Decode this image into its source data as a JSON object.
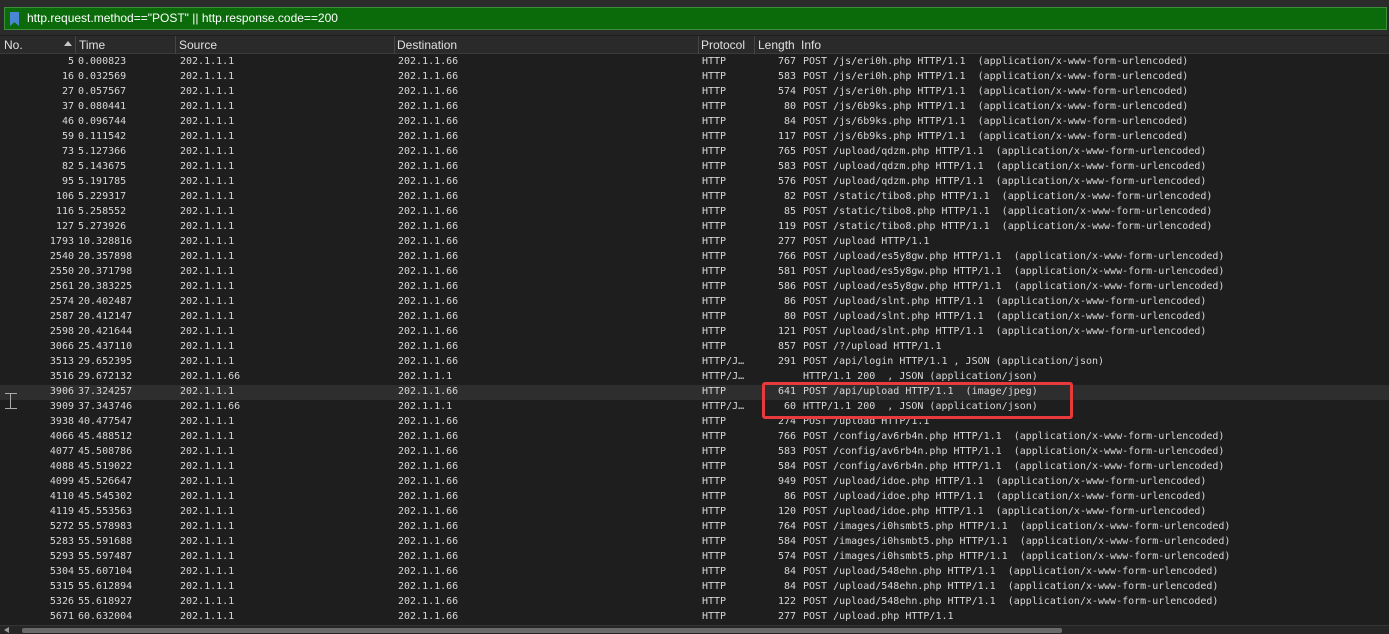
{
  "filter": {
    "expression": "http.request.method==\"POST\" || http.response.code==200"
  },
  "columns": {
    "no": "No.",
    "time": "Time",
    "source": "Source",
    "destination": "Destination",
    "protocol": "Protocol",
    "length": "Length",
    "info": "Info"
  },
  "rows": [
    {
      "no": "5",
      "time": "0.000823",
      "src": "202.1.1.1",
      "dst": "202.1.1.66",
      "proto": "HTTP",
      "len": "767",
      "info": "POST /js/eri0h.php HTTP/1.1  (application/x-www-form-urlencoded)"
    },
    {
      "no": "16",
      "time": "0.032569",
      "src": "202.1.1.1",
      "dst": "202.1.1.66",
      "proto": "HTTP",
      "len": "583",
      "info": "POST /js/eri0h.php HTTP/1.1  (application/x-www-form-urlencoded)"
    },
    {
      "no": "27",
      "time": "0.057567",
      "src": "202.1.1.1",
      "dst": "202.1.1.66",
      "proto": "HTTP",
      "len": "574",
      "info": "POST /js/eri0h.php HTTP/1.1  (application/x-www-form-urlencoded)"
    },
    {
      "no": "37",
      "time": "0.080441",
      "src": "202.1.1.1",
      "dst": "202.1.1.66",
      "proto": "HTTP",
      "len": "80",
      "info": "POST /js/6b9ks.php HTTP/1.1  (application/x-www-form-urlencoded)"
    },
    {
      "no": "46",
      "time": "0.096744",
      "src": "202.1.1.1",
      "dst": "202.1.1.66",
      "proto": "HTTP",
      "len": "84",
      "info": "POST /js/6b9ks.php HTTP/1.1  (application/x-www-form-urlencoded)"
    },
    {
      "no": "59",
      "time": "0.111542",
      "src": "202.1.1.1",
      "dst": "202.1.1.66",
      "proto": "HTTP",
      "len": "117",
      "info": "POST /js/6b9ks.php HTTP/1.1  (application/x-www-form-urlencoded)"
    },
    {
      "no": "73",
      "time": "5.127366",
      "src": "202.1.1.1",
      "dst": "202.1.1.66",
      "proto": "HTTP",
      "len": "765",
      "info": "POST /upload/qdzm.php HTTP/1.1  (application/x-www-form-urlencoded)"
    },
    {
      "no": "82",
      "time": "5.143675",
      "src": "202.1.1.1",
      "dst": "202.1.1.66",
      "proto": "HTTP",
      "len": "583",
      "info": "POST /upload/qdzm.php HTTP/1.1  (application/x-www-form-urlencoded)"
    },
    {
      "no": "95",
      "time": "5.191785",
      "src": "202.1.1.1",
      "dst": "202.1.1.66",
      "proto": "HTTP",
      "len": "576",
      "info": "POST /upload/qdzm.php HTTP/1.1  (application/x-www-form-urlencoded)"
    },
    {
      "no": "106",
      "time": "5.229317",
      "src": "202.1.1.1",
      "dst": "202.1.1.66",
      "proto": "HTTP",
      "len": "82",
      "info": "POST /static/tibo8.php HTTP/1.1  (application/x-www-form-urlencoded)"
    },
    {
      "no": "116",
      "time": "5.258552",
      "src": "202.1.1.1",
      "dst": "202.1.1.66",
      "proto": "HTTP",
      "len": "85",
      "info": "POST /static/tibo8.php HTTP/1.1  (application/x-www-form-urlencoded)"
    },
    {
      "no": "127",
      "time": "5.273926",
      "src": "202.1.1.1",
      "dst": "202.1.1.66",
      "proto": "HTTP",
      "len": "119",
      "info": "POST /static/tibo8.php HTTP/1.1  (application/x-www-form-urlencoded)"
    },
    {
      "no": "1793",
      "time": "10.328816",
      "src": "202.1.1.1",
      "dst": "202.1.1.66",
      "proto": "HTTP",
      "len": "277",
      "info": "POST /upload HTTP/1.1"
    },
    {
      "no": "2540",
      "time": "20.357898",
      "src": "202.1.1.1",
      "dst": "202.1.1.66",
      "proto": "HTTP",
      "len": "766",
      "info": "POST /upload/es5y8gw.php HTTP/1.1  (application/x-www-form-urlencoded)"
    },
    {
      "no": "2550",
      "time": "20.371798",
      "src": "202.1.1.1",
      "dst": "202.1.1.66",
      "proto": "HTTP",
      "len": "581",
      "info": "POST /upload/es5y8gw.php HTTP/1.1  (application/x-www-form-urlencoded)"
    },
    {
      "no": "2561",
      "time": "20.383225",
      "src": "202.1.1.1",
      "dst": "202.1.1.66",
      "proto": "HTTP",
      "len": "586",
      "info": "POST /upload/es5y8gw.php HTTP/1.1  (application/x-www-form-urlencoded)"
    },
    {
      "no": "2574",
      "time": "20.402487",
      "src": "202.1.1.1",
      "dst": "202.1.1.66",
      "proto": "HTTP",
      "len": "86",
      "info": "POST /upload/slnt.php HTTP/1.1  (application/x-www-form-urlencoded)"
    },
    {
      "no": "2587",
      "time": "20.412147",
      "src": "202.1.1.1",
      "dst": "202.1.1.66",
      "proto": "HTTP",
      "len": "80",
      "info": "POST /upload/slnt.php HTTP/1.1  (application/x-www-form-urlencoded)"
    },
    {
      "no": "2598",
      "time": "20.421644",
      "src": "202.1.1.1",
      "dst": "202.1.1.66",
      "proto": "HTTP",
      "len": "121",
      "info": "POST /upload/slnt.php HTTP/1.1  (application/x-www-form-urlencoded)"
    },
    {
      "no": "3066",
      "time": "25.437110",
      "src": "202.1.1.1",
      "dst": "202.1.1.66",
      "proto": "HTTP",
      "len": "857",
      "info": "POST /?/upload HTTP/1.1"
    },
    {
      "no": "3513",
      "time": "29.652395",
      "src": "202.1.1.1",
      "dst": "202.1.1.66",
      "proto": "HTTP/J…",
      "len": "291",
      "info": "POST /api/login HTTP/1.1 , JSON (application/json)"
    },
    {
      "no": "3516",
      "time": "29.672132",
      "src": "202.1.1.66",
      "dst": "202.1.1.1",
      "proto": "HTTP/J…",
      "len": "",
      "info": "HTTP/1.1 200  , JSON (application/json)"
    },
    {
      "no": "3906",
      "time": "37.324257",
      "src": "202.1.1.1",
      "dst": "202.1.1.66",
      "proto": "HTTP",
      "len": "641",
      "info": "POST /api/upload HTTP/1.1  (image/jpeg)",
      "rel": "start",
      "selected": true
    },
    {
      "no": "3909",
      "time": "37.343746",
      "src": "202.1.1.66",
      "dst": "202.1.1.1",
      "proto": "HTTP/J…",
      "len": "60",
      "info": "HTTP/1.1 200  , JSON (application/json)",
      "rel": "end"
    },
    {
      "no": "3938",
      "time": "40.477547",
      "src": "202.1.1.1",
      "dst": "202.1.1.66",
      "proto": "HTTP",
      "len": "274",
      "info": "POST /upload HTTP/1.1"
    },
    {
      "no": "4066",
      "time": "45.488512",
      "src": "202.1.1.1",
      "dst": "202.1.1.66",
      "proto": "HTTP",
      "len": "766",
      "info": "POST /config/av6rb4n.php HTTP/1.1  (application/x-www-form-urlencoded)"
    },
    {
      "no": "4077",
      "time": "45.508786",
      "src": "202.1.1.1",
      "dst": "202.1.1.66",
      "proto": "HTTP",
      "len": "583",
      "info": "POST /config/av6rb4n.php HTTP/1.1  (application/x-www-form-urlencoded)"
    },
    {
      "no": "4088",
      "time": "45.519022",
      "src": "202.1.1.1",
      "dst": "202.1.1.66",
      "proto": "HTTP",
      "len": "584",
      "info": "POST /config/av6rb4n.php HTTP/1.1  (application/x-www-form-urlencoded)"
    },
    {
      "no": "4099",
      "time": "45.526647",
      "src": "202.1.1.1",
      "dst": "202.1.1.66",
      "proto": "HTTP",
      "len": "949",
      "info": "POST /upload/idoe.php HTTP/1.1  (application/x-www-form-urlencoded)"
    },
    {
      "no": "4110",
      "time": "45.545302",
      "src": "202.1.1.1",
      "dst": "202.1.1.66",
      "proto": "HTTP",
      "len": "86",
      "info": "POST /upload/idoe.php HTTP/1.1  (application/x-www-form-urlencoded)"
    },
    {
      "no": "4119",
      "time": "45.553563",
      "src": "202.1.1.1",
      "dst": "202.1.1.66",
      "proto": "HTTP",
      "len": "120",
      "info": "POST /upload/idoe.php HTTP/1.1  (application/x-www-form-urlencoded)"
    },
    {
      "no": "5272",
      "time": "55.578983",
      "src": "202.1.1.1",
      "dst": "202.1.1.66",
      "proto": "HTTP",
      "len": "764",
      "info": "POST /images/i0hsmbt5.php HTTP/1.1  (application/x-www-form-urlencoded)"
    },
    {
      "no": "5283",
      "time": "55.591688",
      "src": "202.1.1.1",
      "dst": "202.1.1.66",
      "proto": "HTTP",
      "len": "584",
      "info": "POST /images/i0hsmbt5.php HTTP/1.1  (application/x-www-form-urlencoded)"
    },
    {
      "no": "5293",
      "time": "55.597487",
      "src": "202.1.1.1",
      "dst": "202.1.1.66",
      "proto": "HTTP",
      "len": "574",
      "info": "POST /images/i0hsmbt5.php HTTP/1.1  (application/x-www-form-urlencoded)"
    },
    {
      "no": "5304",
      "time": "55.607104",
      "src": "202.1.1.1",
      "dst": "202.1.1.66",
      "proto": "HTTP",
      "len": "84",
      "info": "POST /upload/548ehn.php HTTP/1.1  (application/x-www-form-urlencoded)"
    },
    {
      "no": "5315",
      "time": "55.612894",
      "src": "202.1.1.1",
      "dst": "202.1.1.66",
      "proto": "HTTP",
      "len": "84",
      "info": "POST /upload/548ehn.php HTTP/1.1  (application/x-www-form-urlencoded)"
    },
    {
      "no": "5326",
      "time": "55.618927",
      "src": "202.1.1.1",
      "dst": "202.1.1.66",
      "proto": "HTTP",
      "len": "122",
      "info": "POST /upload/548ehn.php HTTP/1.1  (application/x-www-form-urlencoded)"
    },
    {
      "no": "5671",
      "time": "60.632004",
      "src": "202.1.1.1",
      "dst": "202.1.1.66",
      "proto": "HTTP",
      "len": "277",
      "info": "POST /upload.php HTTP/1.1"
    }
  ],
  "colors": {
    "filter_bg": "#0b6b0b",
    "highlight": "#e8393c",
    "background": "#1e1e1e"
  }
}
